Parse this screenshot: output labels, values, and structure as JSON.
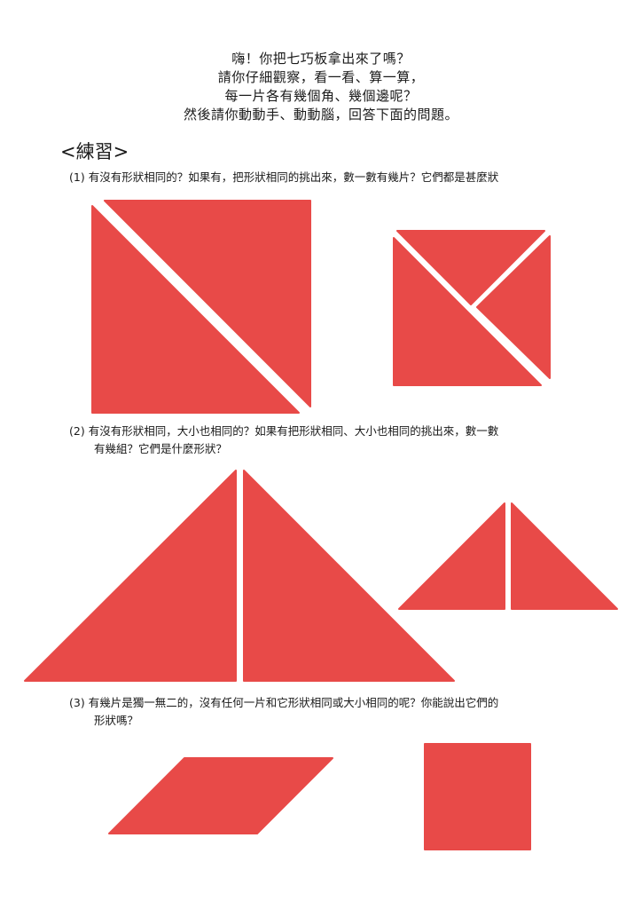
{
  "intro": {
    "lines": [
      "嗨！你把七巧板拿出來了嗎？",
      "請你仔細觀察，看一看、算一算，",
      "每一片各有幾個角、幾個邊呢？",
      "然後請你動動手、動動腦，回答下面的問題。"
    ]
  },
  "practice": {
    "heading": "<練習>"
  },
  "questions": [
    {
      "number": "(1)",
      "line1": "有沒有形狀相同的？如果有，把形狀相同的挑出來，數一數有幾片？它們都是甚麼狀",
      "line2": ""
    },
    {
      "number": "(2)",
      "line1": "有沒有形狀相同，大小也相同的？如果有把形狀相同、大小也相同的挑出來，數一數",
      "line2": "有幾組？它們是什麼形狀？"
    },
    {
      "number": "(3)",
      "line1": "有幾片是獨一無二的，沒有任何一片和它形狀相同或大小相同的呢？你能說出它們的",
      "line2": "形狀嗎？"
    }
  ],
  "colors": {
    "tile": "#e84a48",
    "text": "#1a1a1a",
    "background": "#ffffff"
  }
}
